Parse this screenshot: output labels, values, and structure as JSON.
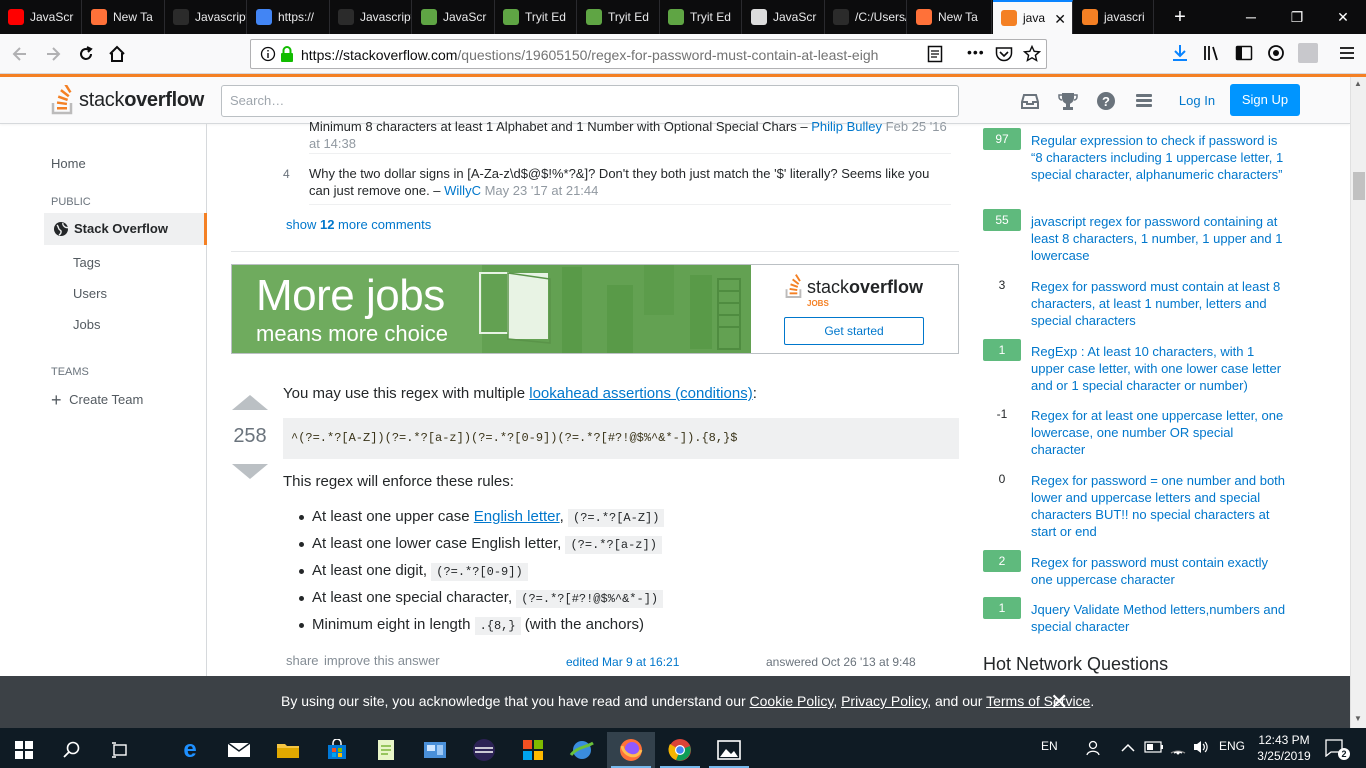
{
  "browser": {
    "tabs": [
      {
        "label": "JavaScr",
        "color": "#ff0000"
      },
      {
        "label": "New Ta",
        "color": "#ff7139"
      },
      {
        "label": "Javascript F",
        "color": "#2b2b2b"
      },
      {
        "label": "https://",
        "color": "#4285f4"
      },
      {
        "label": "Javascript F",
        "color": "#2b2b2b"
      },
      {
        "label": "JavaScr",
        "color": "#5fa544"
      },
      {
        "label": "Tryit Ed",
        "color": "#5fa544"
      },
      {
        "label": "Tryit Ed",
        "color": "#5fa544"
      },
      {
        "label": "Tryit Ed",
        "color": "#5fa544"
      },
      {
        "label": "JavaScr",
        "color": "#dddddd"
      },
      {
        "label": "/C:/Users/v",
        "color": "#2b2b2b"
      },
      {
        "label": "New Ta",
        "color": "#ff7139"
      },
      {
        "label": "java",
        "color": "#f48024"
      },
      {
        "label": "javascri",
        "color": "#f48024"
      }
    ],
    "active_tab_close": "✕",
    "new_tab": "+",
    "url_host": "https://stackoverflow.com",
    "url_path": "/questions/19605150/regex-for-password-must-contain-at-least-eigh",
    "page_actions": "•••"
  },
  "so": {
    "logo_word_1": "stack",
    "logo_word_2": "overflow",
    "search_placeholder": "Search…",
    "login": "Log In",
    "signup": "Sign Up",
    "brand_orange": "#f48024",
    "link_blue": "#0077cc"
  },
  "leftnav": {
    "home": "Home",
    "public_heading": "PUBLIC",
    "stack_overflow": "Stack Overflow",
    "tags": "Tags",
    "users": "Users",
    "jobs": "Jobs",
    "teams_heading": "TEAMS",
    "create_team": "Create Team"
  },
  "comments": [
    {
      "score": "",
      "text": "Minimum 8 characters at least 1 Alphabet and 1 Number with Optional Special Chars – ",
      "user": "Philip Bulley",
      "date": "Feb 25 '16",
      "date2": "at 14:38"
    },
    {
      "score": "4",
      "text": "Why the two dollar signs in [A-Za-z\\d$@$!%*?&]? Don't they both just match the '$' literally? Seems like you can just remove one. – ",
      "user": "WillyC",
      "date": "May 23 '17 at 21:44"
    }
  ],
  "show_more": {
    "prefix": "show ",
    "count": "12",
    "suffix": " more comments"
  },
  "ad": {
    "headline": "More jobs",
    "subline": "means more choice",
    "logo_word_1": "stack",
    "logo_word_2": "overflow",
    "logo_sub": "JOBS",
    "cta": "Get started"
  },
  "answer": {
    "votes": "258",
    "intro_prefix": "You may use this regex with multiple ",
    "intro_link": "lookahead assertions (conditions)",
    "intro_suffix": ":",
    "code": "^(?=.*?[A-Z])(?=.*?[a-z])(?=.*?[0-9])(?=.*?[#?!@$%^&*-]).{8,}$",
    "rules_intro": "This regex will enforce these rules:",
    "rules": [
      {
        "prefix": "At least one upper case ",
        "link": "English letter",
        "suffix": ", ",
        "code": "(?=.*?[A-Z])",
        "after": ""
      },
      {
        "prefix": "At least one lower case English letter, ",
        "link": "",
        "suffix": "",
        "code": "(?=.*?[a-z])",
        "after": ""
      },
      {
        "prefix": "At least one digit, ",
        "link": "",
        "suffix": "",
        "code": "(?=.*?[0-9])",
        "after": ""
      },
      {
        "prefix": "At least one special character, ",
        "link": "",
        "suffix": "",
        "code": "(?=.*?[#?!@$%^&*-])",
        "after": ""
      },
      {
        "prefix": "Minimum eight in length ",
        "link": "",
        "suffix": "",
        "code": ".{8,}",
        "after": " (with the anchors)"
      }
    ],
    "share": "share",
    "improve": "improve this answer",
    "edited": "edited Mar 9 at 16:21",
    "answered": "answered Oct 26 '13 at 9:48"
  },
  "related": [
    {
      "score": "97",
      "answered": true,
      "title": "Regular expression to check if password is “8 characters including 1 uppercase letter, 1 special character, alphanumeric characters”"
    },
    {
      "score": "55",
      "answered": true,
      "title": "javascript regex for password containing at least 8 characters, 1 number, 1 upper and 1 lowercase"
    },
    {
      "score": "3",
      "answered": false,
      "title": "Regex for password must contain at least 8 characters, at least 1 number, letters and special characters"
    },
    {
      "score": "1",
      "answered": true,
      "title": "RegExp : At least 10 characters, with 1 upper case letter, with one lower case letter and or 1 special character or number)"
    },
    {
      "score": "-1",
      "answered": false,
      "title": "Regex for at least one uppercase letter, one lowercase, one number OR special character"
    },
    {
      "score": "0",
      "answered": false,
      "title": "Regex for password = one number and both lower and uppercase letters and special characters BUT!! no special characters at start or end"
    },
    {
      "score": "2",
      "answered": true,
      "title": "Regex for password must contain exactly one uppercase character"
    },
    {
      "score": "1",
      "answered": true,
      "title": "Jquery Validate Method letters,numbers and special character"
    }
  ],
  "hot_network": "Hot Network Questions",
  "cookie": {
    "prefix": "By using our site, you acknowledge that you have read and understand our ",
    "cookie_policy": "Cookie Policy",
    "sep1": ", ",
    "privacy_policy": "Privacy Policy",
    "sep2": ", and our ",
    "terms": "Terms of Service",
    "suffix": ".",
    "close": "✕"
  },
  "taskbar": {
    "lang": "EN",
    "ime": "ENG",
    "time": "12:43 PM",
    "date": "3/25/2019",
    "notifications": "2"
  }
}
